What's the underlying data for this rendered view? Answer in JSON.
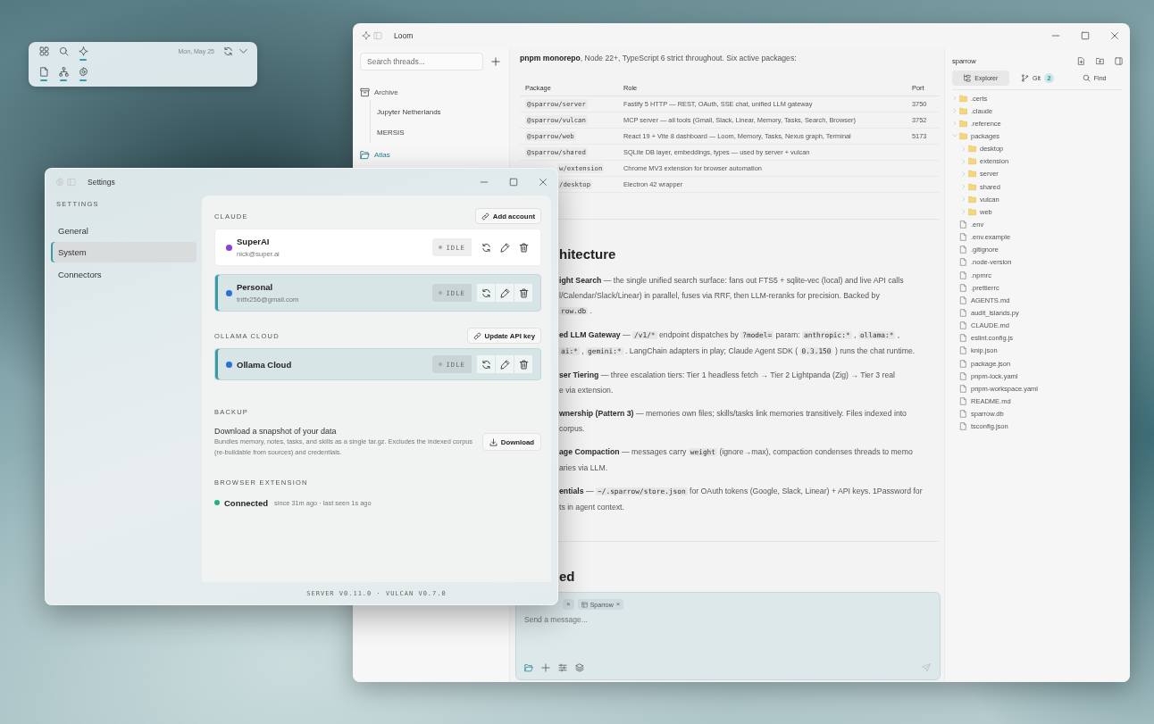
{
  "dock": {
    "top": [
      {
        "active": false
      },
      {
        "active": false
      },
      {
        "active": true
      }
    ],
    "date": "Mon, May 25",
    "bottom": [
      {
        "active": true
      },
      {
        "active": true
      },
      {
        "active": true
      }
    ]
  },
  "loom": {
    "title": "Loom",
    "sidebar": {
      "search": {
        "placeholder": "Search threads..."
      },
      "folders": [
        {
          "kind": "archive",
          "label": "Archive",
          "selected": false,
          "children": [
            {
              "label": "Jupyter Netherlands",
              "selected": false
            },
            {
              "label": "MERSIS",
              "selected": false
            }
          ]
        },
        {
          "kind": "folder",
          "label": "Atlas",
          "selected": true
        }
      ]
    },
    "document": {
      "intro": "**pnpm monorepo**, Node 22+, TypeScript 6 strict throughout. Six active packages:",
      "table": {
        "columns": [
          "Package",
          "Role",
          "Port"
        ],
        "rows": [
          {
            "package": "@sparrow/server",
            "role": "Fastify 5 HTTP — REST, OAuth, SSE chat, unified LLM gateway",
            "port": "3750"
          },
          {
            "package": "@sparrow/vulcan",
            "role": "MCP server — all tools (Gmail, Slack, Linear, Memory, Tasks, Search, Browser)",
            "port": "3752"
          },
          {
            "package": "@sparrow/web",
            "role": "React 19 + Vite 8 dashboard — Loom, Memory, Tasks, Nexus graph, Terminal",
            "port": "5173"
          },
          {
            "package": "@sparrow/shared",
            "role": "SQLite DB layer, embeddings, types — used by server + vulcan"
          },
          {
            "package": "w/extension",
            "role": "Chrome MV3 extension for browser automation"
          },
          {
            "package": "/desktop",
            "role": "Electron 42 wrapper"
          }
        ]
      },
      "heading_1": "hitecture",
      "paragraphs": [
        {
          "lines": [
            [
              {
                "kind": "bold",
                "text": "ight Search"
              },
              {
                "kind": "text",
                "text": " — the single unified search surface: fans out FTS5 + sqlite-vec (local) and live API calls"
              }
            ],
            [
              {
                "kind": "text",
                "text": "l/Calendar/Slack/Linear) in parallel, fuses via RRF, then LLM-reranks for precision. Backed by"
              }
            ],
            [
              {
                "kind": "code",
                "text": "row.db"
              },
              {
                "kind": "text",
                "text": " ."
              }
            ]
          ]
        },
        {
          "lines": [
            [
              {
                "kind": "bold",
                "text": "ed LLM Gateway"
              },
              {
                "kind": "text",
                "text": " — "
              },
              {
                "kind": "code",
                "text": "/v1/*"
              },
              {
                "kind": "text",
                "text": " endpoint dispatches by "
              },
              {
                "kind": "code",
                "text": "?model="
              },
              {
                "kind": "text",
                "text": " param: "
              },
              {
                "kind": "code",
                "text": "anthropic:*"
              },
              {
                "kind": "text",
                "text": " , "
              },
              {
                "kind": "code",
                "text": "ollama:*"
              },
              {
                "kind": "text",
                "text": " ,"
              }
            ],
            [
              {
                "kind": "code",
                "text": "ai:*"
              },
              {
                "kind": "text",
                "text": " , "
              },
              {
                "kind": "code",
                "text": "gemini:*"
              },
              {
                "kind": "text",
                "text": " . LangChain adapters in play; Claude Agent SDK ( "
              },
              {
                "kind": "code",
                "text": "0.3.150"
              },
              {
                "kind": "text",
                "text": " ) runs the chat runtime."
              }
            ]
          ]
        },
        {
          "lines": [
            [
              {
                "kind": "bold",
                "text": "ser Tiering"
              },
              {
                "kind": "text",
                "text": " — three escalation tiers: Tier 1 headless fetch → Tier 2 Lightpanda (Zig) → Tier 3 real"
              }
            ],
            [
              {
                "kind": "text",
                "text": "e via extension."
              }
            ]
          ]
        },
        {
          "lines": [
            [
              {
                "kind": "bold",
                "text": "wnership (Pattern 3)"
              },
              {
                "kind": "text",
                "text": " — memories own files; skills/tasks link memories transitively. Files indexed into"
              }
            ],
            [
              {
                "kind": "text",
                "text": "corpus."
              }
            ]
          ]
        },
        {
          "lines": [
            [
              {
                "kind": "bold",
                "text": "age Compaction"
              },
              {
                "kind": "text",
                "text": " — messages carry "
              },
              {
                "kind": "code",
                "text": "weight"
              },
              {
                "kind": "text",
                "text": " (ignore→max), compaction condenses threads to memo"
              }
            ],
            [
              {
                "kind": "text",
                "text": "aries via LLM."
              }
            ]
          ]
        },
        {
          "lines": [
            [
              {
                "kind": "bold",
                "text": "entials"
              },
              {
                "kind": "text",
                "text": " — "
              },
              {
                "kind": "code",
                "text": "~/.sparrow/store.json"
              },
              {
                "kind": "text",
                "text": " for OAuth tokens (Google, Slack, Linear) + API keys. 1Password for"
              }
            ],
            [
              {
                "kind": "text",
                "text": "ts in agent context."
              }
            ]
          ]
        }
      ],
      "heading_2": "ed"
    },
    "composer": {
      "chips": [
        {
          "close": "×"
        },
        {
          "label": "Sparrow",
          "close": "×"
        }
      ],
      "placeholder": "Send a message..."
    },
    "explorer": {
      "title": "sparrow",
      "tabs": [
        {
          "label": "Explorer",
          "selected": true
        },
        {
          "label": "Git",
          "badge": "2",
          "selected": false
        },
        {
          "label": "Find",
          "selected": false
        }
      ],
      "tree": [
        {
          "kind": "folder",
          "name": ".certs",
          "expanded": false
        },
        {
          "kind": "folder",
          "name": ".claude",
          "expanded": false
        },
        {
          "kind": "folder",
          "name": ".reference",
          "expanded": false
        },
        {
          "kind": "folder",
          "name": "packages",
          "expanded": true,
          "children": [
            {
              "kind": "folder",
              "name": "desktop",
              "expanded": false
            },
            {
              "kind": "folder",
              "name": "extension",
              "expanded": false
            },
            {
              "kind": "folder",
              "name": "server",
              "expanded": false
            },
            {
              "kind": "folder",
              "name": "shared",
              "expanded": false
            },
            {
              "kind": "folder",
              "name": "vulcan",
              "expanded": false
            },
            {
              "kind": "folder",
              "name": "web",
              "expanded": false
            }
          ]
        },
        {
          "kind": "file",
          "name": ".env"
        },
        {
          "kind": "file",
          "name": ".env.example"
        },
        {
          "kind": "file",
          "name": ".gitignore"
        },
        {
          "kind": "file",
          "name": ".node-version"
        },
        {
          "kind": "file",
          "name": ".npmrc"
        },
        {
          "kind": "file",
          "name": ".prettierrc"
        },
        {
          "kind": "file",
          "name": "AGENTS.md"
        },
        {
          "kind": "file",
          "name": "audit_islands.py"
        },
        {
          "kind": "file",
          "name": "CLAUDE.md"
        },
        {
          "kind": "file",
          "name": "eslint.config.js"
        },
        {
          "kind": "file",
          "name": "knip.json"
        },
        {
          "kind": "file",
          "name": "package.json"
        },
        {
          "kind": "file",
          "name": "pnpm-lock.yaml"
        },
        {
          "kind": "file",
          "name": "pnpm-workspace.yaml"
        },
        {
          "kind": "file",
          "name": "README.md"
        },
        {
          "kind": "file",
          "name": "sparrow.db"
        },
        {
          "kind": "file",
          "name": "tsconfig.json"
        }
      ]
    }
  },
  "settings": {
    "title": "Settings",
    "nav_heading": "SETTINGS",
    "nav": [
      {
        "label": "General",
        "selected": false
      },
      {
        "label": "System",
        "selected": true
      },
      {
        "label": "Connectors",
        "selected": false
      }
    ],
    "sections": [
      {
        "kind": "accounts",
        "heading": "CLAUDE",
        "action": "Add account",
        "accounts": [
          {
            "name": "SuperAI",
            "email": "nick@super.ai",
            "color": "#8e3fd6",
            "status": "IDLE",
            "selected": false
          },
          {
            "name": "Personal",
            "email": "tntfx256@gmail.com",
            "color": "#2c6fd9",
            "status": "IDLE",
            "selected": true
          }
        ]
      },
      {
        "kind": "accounts",
        "heading": "OLLAMA CLOUD",
        "action": "Update API key",
        "accounts": [
          {
            "name": "Ollama Cloud",
            "color": "#2c6fd9",
            "status": "IDLE",
            "selected": true
          }
        ]
      },
      {
        "kind": "backup",
        "heading": "BACKUP",
        "title": "Download a snapshot of your data",
        "description": "Bundles memory, notes, tasks, and skills as a single tar.gz. Excludes the indexed corpus (re-buildable from sources) and credentials.",
        "action": "Download"
      },
      {
        "kind": "extension",
        "heading": "BROWSER EXTENSION",
        "connected": true,
        "status": "Connected",
        "detail": "since 31m ago · last seen 1s ago"
      }
    ],
    "footer": "SERVER V0.11.0 · VULCAN V0.7.0"
  }
}
